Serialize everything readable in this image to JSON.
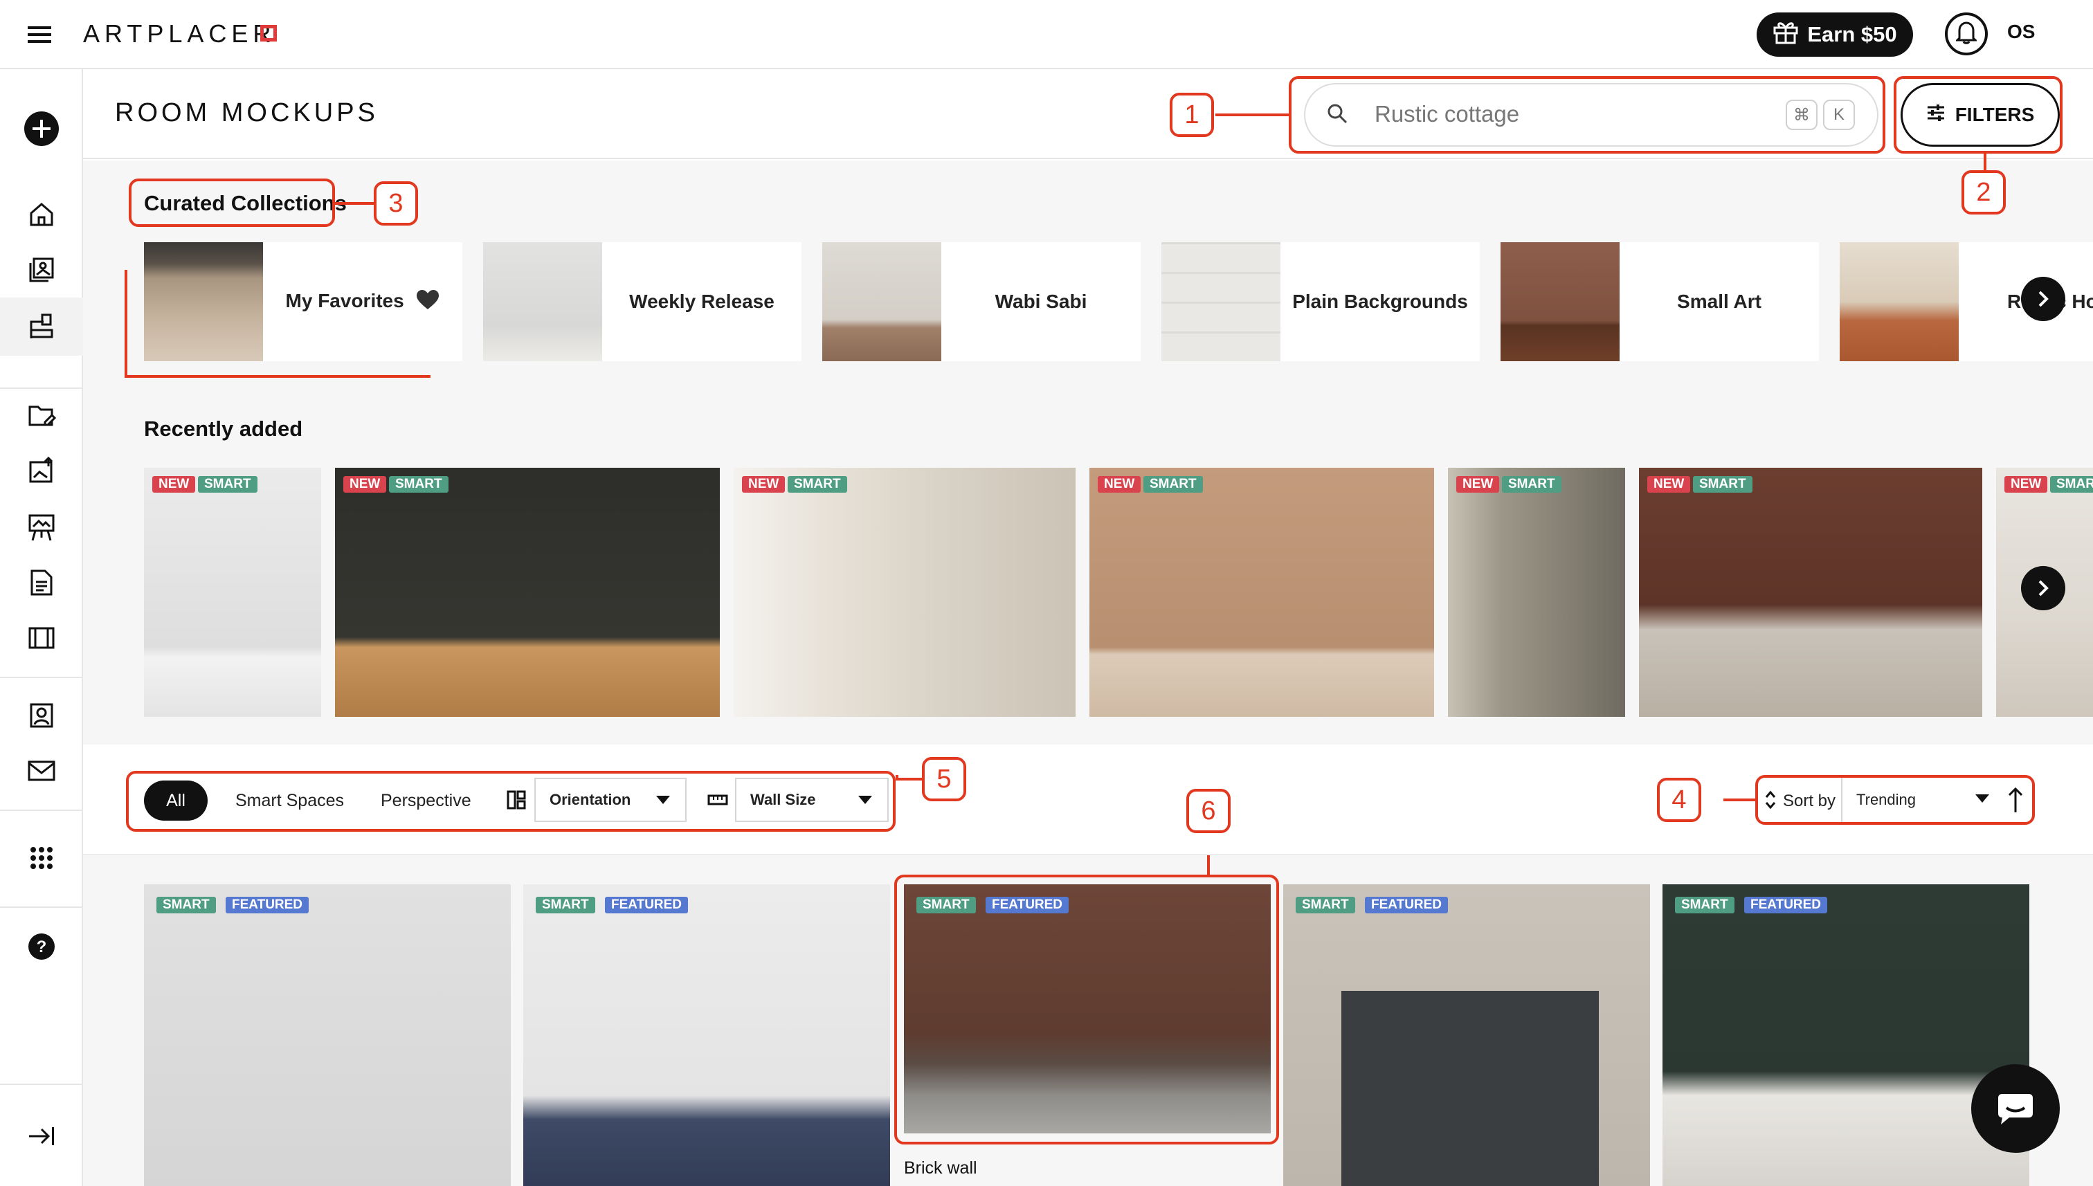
{
  "app": {
    "logo_text": "ARTPLACER"
  },
  "header": {
    "earn_label": "Earn $50",
    "user_initials": "OS"
  },
  "page": {
    "title": "ROOM MOCKUPS"
  },
  "search": {
    "placeholder": "Rustic cottage",
    "shortcut_1": "⌘",
    "shortcut_2": "K"
  },
  "filters_button": {
    "label": "FILTERS"
  },
  "curated": {
    "title": "Curated Collections",
    "items": [
      {
        "label": "My Favorites"
      },
      {
        "label": "Weekly Release"
      },
      {
        "label": "Wabi Sabi"
      },
      {
        "label": "Plain Backgrounds"
      },
      {
        "label": "Small Art"
      },
      {
        "label": "Rustic Home"
      }
    ]
  },
  "recent": {
    "title": "Recently added",
    "badge_new": "NEW",
    "badge_smart": "SMART"
  },
  "filter_bar": {
    "chips": [
      "All",
      "Smart Spaces",
      "Perspective"
    ],
    "orientation_label": "Orientation",
    "wall_size_label": "Wall Size"
  },
  "sort": {
    "label": "Sort by",
    "value": "Trending"
  },
  "grid": {
    "badge_smart": "SMART",
    "badge_featured": "FEATURED",
    "caption_3": "Brick wall"
  },
  "callouts": [
    "1",
    "2",
    "3",
    "4",
    "5",
    "6"
  ],
  "colors": {
    "accent": "#e2381f",
    "badge_new": "#d9434e",
    "badge_smart": "#4f9e84",
    "badge_featured": "#5579d0"
  }
}
